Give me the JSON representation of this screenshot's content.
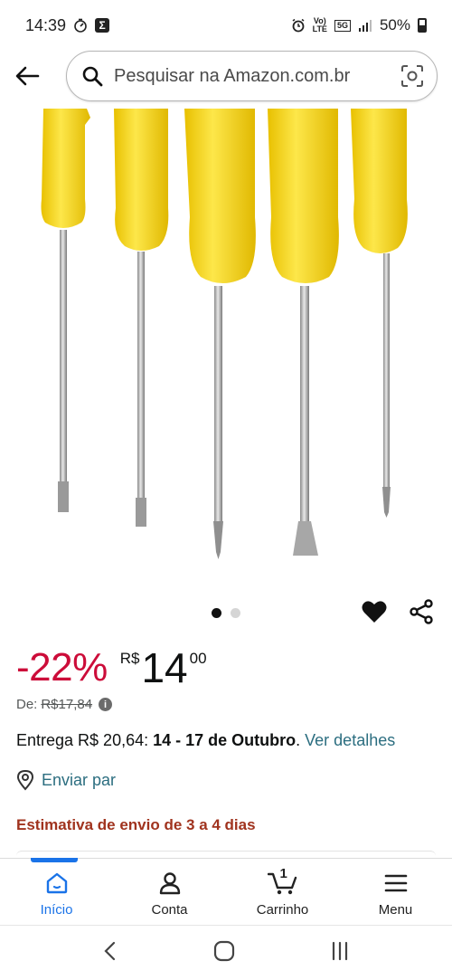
{
  "status_bar": {
    "time": "14:39",
    "sigma": "Σ",
    "volte": "Vo)\nLTE",
    "network": "5G",
    "battery": "50%"
  },
  "search": {
    "placeholder": "Pesquisar na Amazon.com.br"
  },
  "carousel": {
    "total": 2,
    "active_index": 0
  },
  "price": {
    "discount": "-22%",
    "currency": "R$",
    "whole": "14",
    "cents": "00",
    "list_label": "De:",
    "list_value": "R$17,84",
    "info_glyph": "i"
  },
  "delivery": {
    "prefix": "Entrega R$ 20,64: ",
    "dates": "14 - 17 de Outubro",
    "separator": ". ",
    "link": "Ver detalhes"
  },
  "send_to": {
    "label": "Enviar par"
  },
  "estimate": {
    "text": "Estimativa de envio de 3 a 4 dias"
  },
  "bottom_nav": {
    "items": [
      {
        "label": "Início",
        "icon": "home-icon"
      },
      {
        "label": "Conta",
        "icon": "person-icon"
      },
      {
        "label": "Carrinho",
        "icon": "cart-icon",
        "badge": "1"
      },
      {
        "label": "Menu",
        "icon": "menu-icon"
      }
    ],
    "active": 0
  },
  "colors": {
    "discount": "#cc0c39",
    "link": "#2c6e80",
    "estimate": "#a0331e",
    "nav_active": "#1a73e8",
    "handle_yellow": "#f8d621"
  }
}
